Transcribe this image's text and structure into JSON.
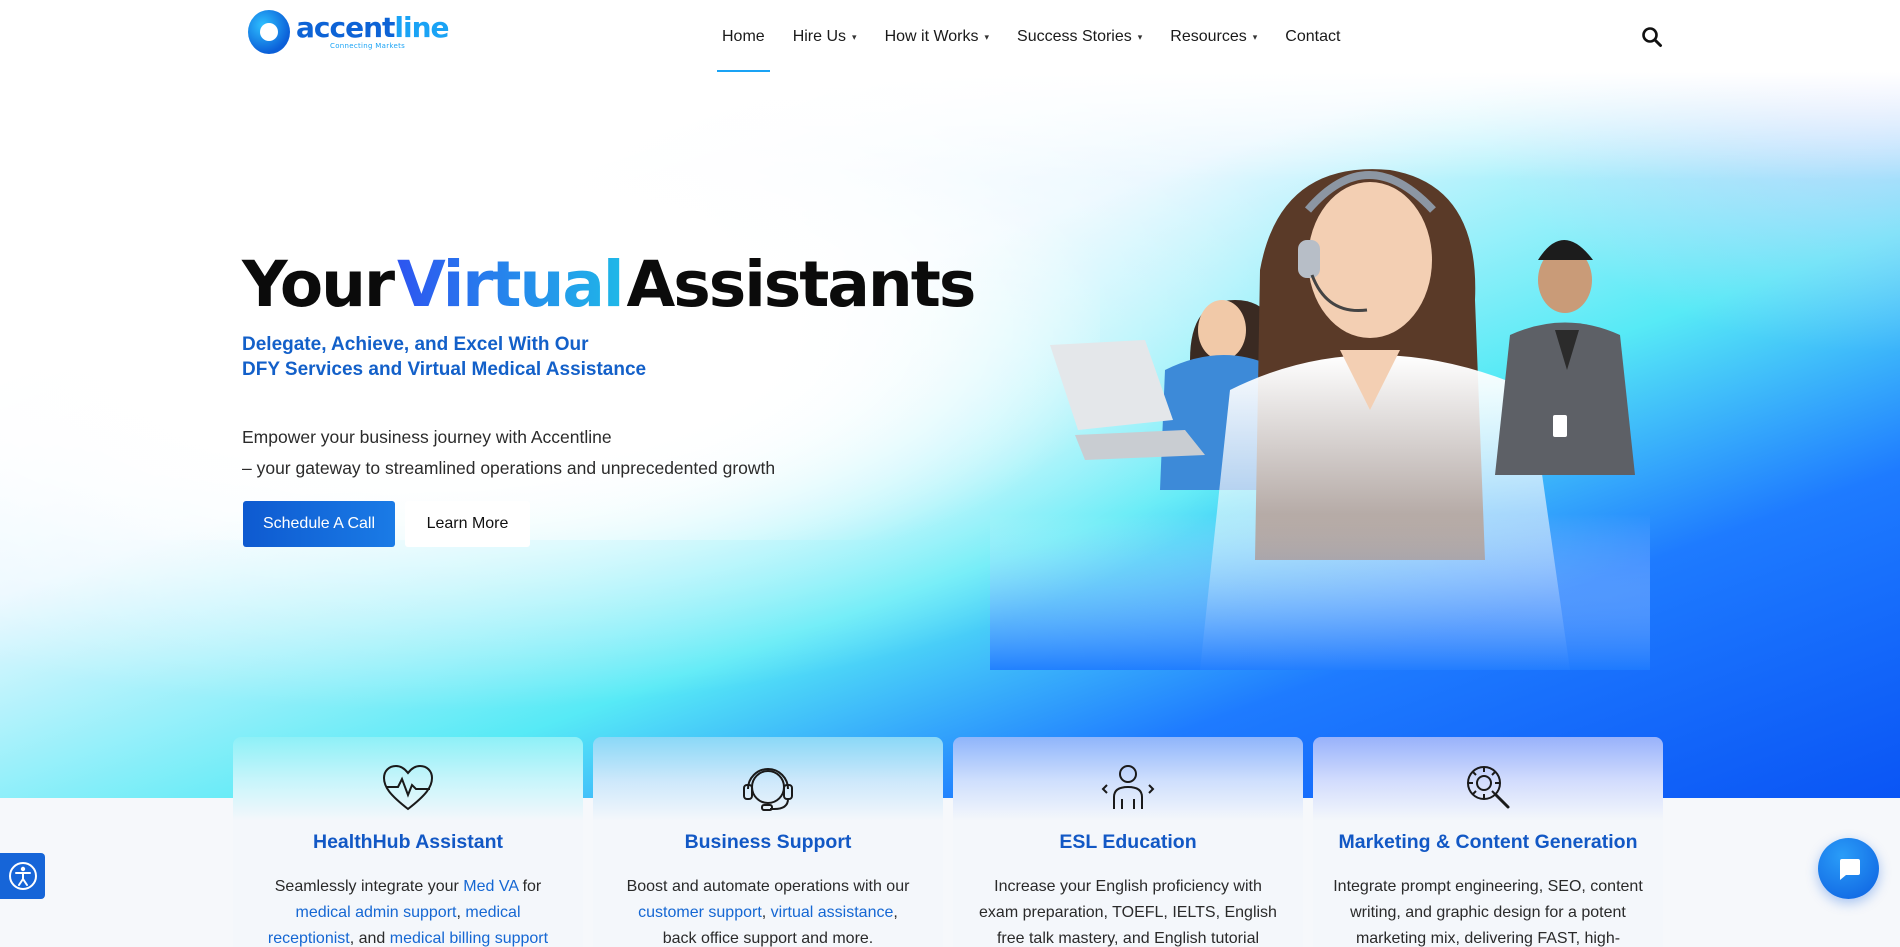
{
  "colors": {
    "brand_blue": "#1258c5",
    "accent_cyan": "#1aa3f5",
    "button_blue": "#0e5ad0",
    "link_blue": "#1567d3"
  },
  "logo": {
    "word_part1": "accent",
    "word_part2": "line",
    "tagline": "Connecting Markets"
  },
  "nav": {
    "items": [
      {
        "label": "Home",
        "active": true,
        "dropdown": false
      },
      {
        "label": "Hire Us",
        "active": false,
        "dropdown": true
      },
      {
        "label": "How it Works",
        "active": false,
        "dropdown": true
      },
      {
        "label": "Success Stories",
        "active": false,
        "dropdown": true
      },
      {
        "label": "Resources",
        "active": false,
        "dropdown": true
      },
      {
        "label": "Contact",
        "active": false,
        "dropdown": false
      }
    ],
    "search_icon": "search-icon"
  },
  "hero": {
    "title_word1": "Your",
    "title_word2": "Virtual",
    "title_word3": "Assistants",
    "subtitle_line1": "Delegate, Achieve, and Excel With Our",
    "subtitle_line2": "DFY Services and Virtual Medical Assistance",
    "desc_line1": "Empower your business journey with Accentline",
    "desc_line2": "– your gateway to streamlined operations and unprecedented growth",
    "primary_button": "Schedule A Call",
    "secondary_button": "Learn More"
  },
  "cards": [
    {
      "icon": "heartbeat-icon",
      "title": "HealthHub Assistant",
      "text_1": "Seamlessly integrate your ",
      "link_1": "Med VA",
      "text_2": " for",
      "link_2": "medical admin support",
      "text_3": ", ",
      "link_3": "medical",
      "link_4": "receptionist",
      "text_4": ", and ",
      "link_5": "medical billing support"
    },
    {
      "icon": "headset-icon",
      "title": "Business Support",
      "text_1": "Boost and automate operations with our",
      "link_1": "customer support",
      "text_2": ", ",
      "link_2": "virtual assistance",
      "text_3": ",",
      "text_4": "back office support and more."
    },
    {
      "icon": "person-arrows-icon",
      "title": "ESL Education",
      "text_1": "Increase your English proficiency with",
      "text_2": "exam preparation, TOEFL, IELTS, English",
      "text_3": "free talk mastery, and English tutorial"
    },
    {
      "icon": "gear-magnifier-icon",
      "title": "Marketing & Content Generation",
      "text_1": "Integrate prompt engineering, SEO, content",
      "text_2": "writing, and graphic design for a potent",
      "text_3": "marketing mix, delivering FAST, high-quality"
    }
  ],
  "widgets": {
    "accessibility_icon": "accessibility-icon",
    "chat_icon": "chat-bubble-icon"
  }
}
